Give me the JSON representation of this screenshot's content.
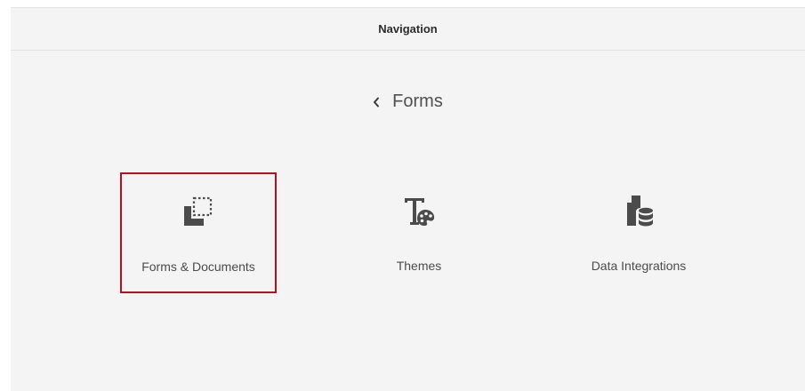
{
  "header": {
    "title": "Navigation"
  },
  "breadcrumb": {
    "back_icon": "chevron-left-icon",
    "label": "Forms"
  },
  "tiles": [
    {
      "label": "Forms & Documents",
      "icon": "forms-documents-icon",
      "selected": true
    },
    {
      "label": "Themes",
      "icon": "themes-icon",
      "selected": false
    },
    {
      "label": "Data Integrations",
      "icon": "data-integrations-icon",
      "selected": false
    }
  ],
  "colors": {
    "panel_background": "#f4f4f4",
    "selection_border": "#b5121b",
    "icon": "#4b4b4b"
  }
}
